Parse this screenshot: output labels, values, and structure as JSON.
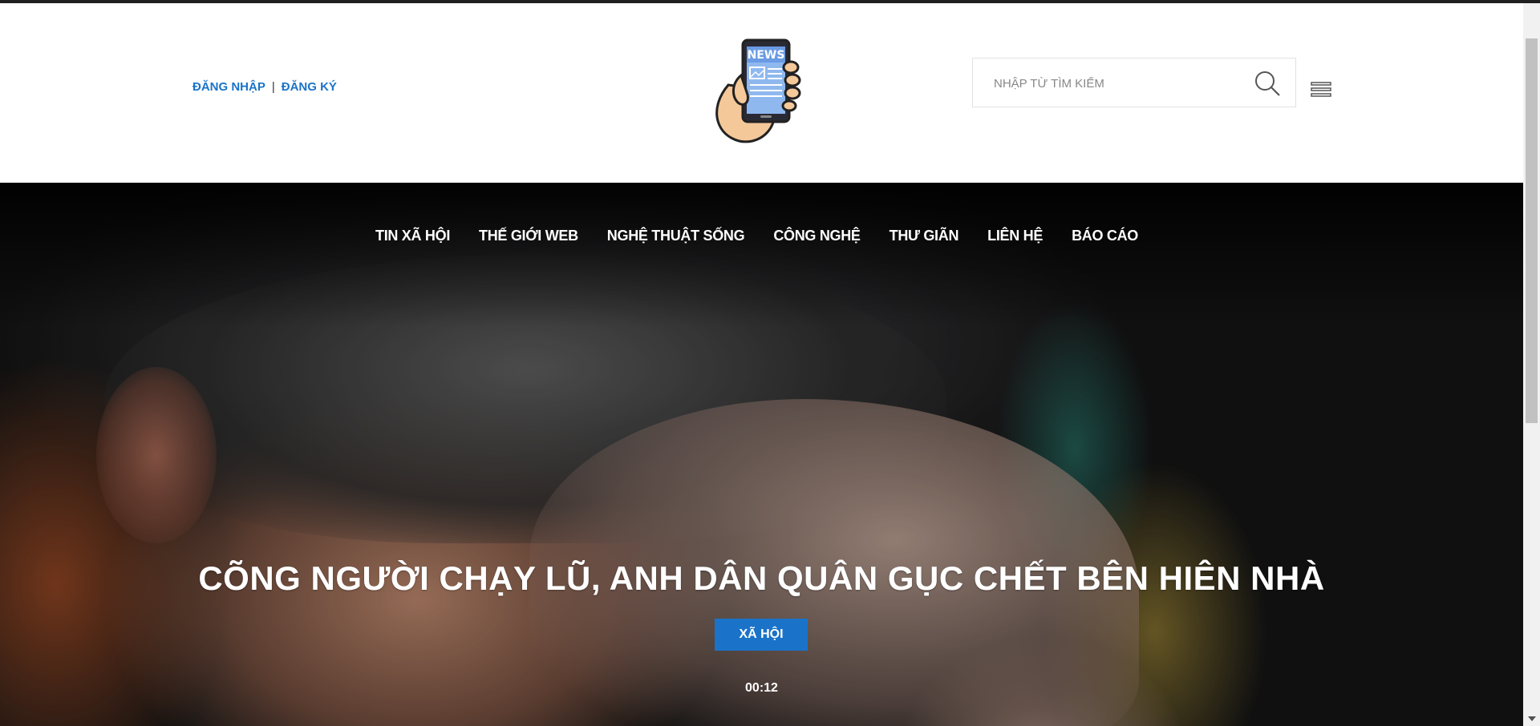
{
  "header": {
    "login_label": "ĐĂNG NHẬP",
    "separator": "|",
    "register_label": "ĐĂNG KÝ",
    "logo_text": "NEWS",
    "search": {
      "placeholder": "NHẬP TỪ TÌM KIẾM",
      "icon": "search-icon"
    },
    "menu_icon": "hamburger-menu-icon"
  },
  "nav": {
    "items": [
      {
        "label": "TIN XÃ HỘI"
      },
      {
        "label": "THẾ GIỚI WEB"
      },
      {
        "label": "NGHỆ THUẬT SỐNG"
      },
      {
        "label": "CÔNG NGHỆ"
      },
      {
        "label": "THƯ GIÃN"
      },
      {
        "label": "LIÊN HỆ"
      },
      {
        "label": "BÁO CÁO"
      }
    ]
  },
  "hero": {
    "title": "CÕNG NGƯỜI CHẠY LŨ, ANH DÂN QUÂN GỤC CHẾT BÊN HIÊN NHÀ",
    "category": "XÃ HỘI",
    "time": "00:12"
  },
  "colors": {
    "accent": "#1a73c8",
    "nav_text": "#ffffff"
  }
}
